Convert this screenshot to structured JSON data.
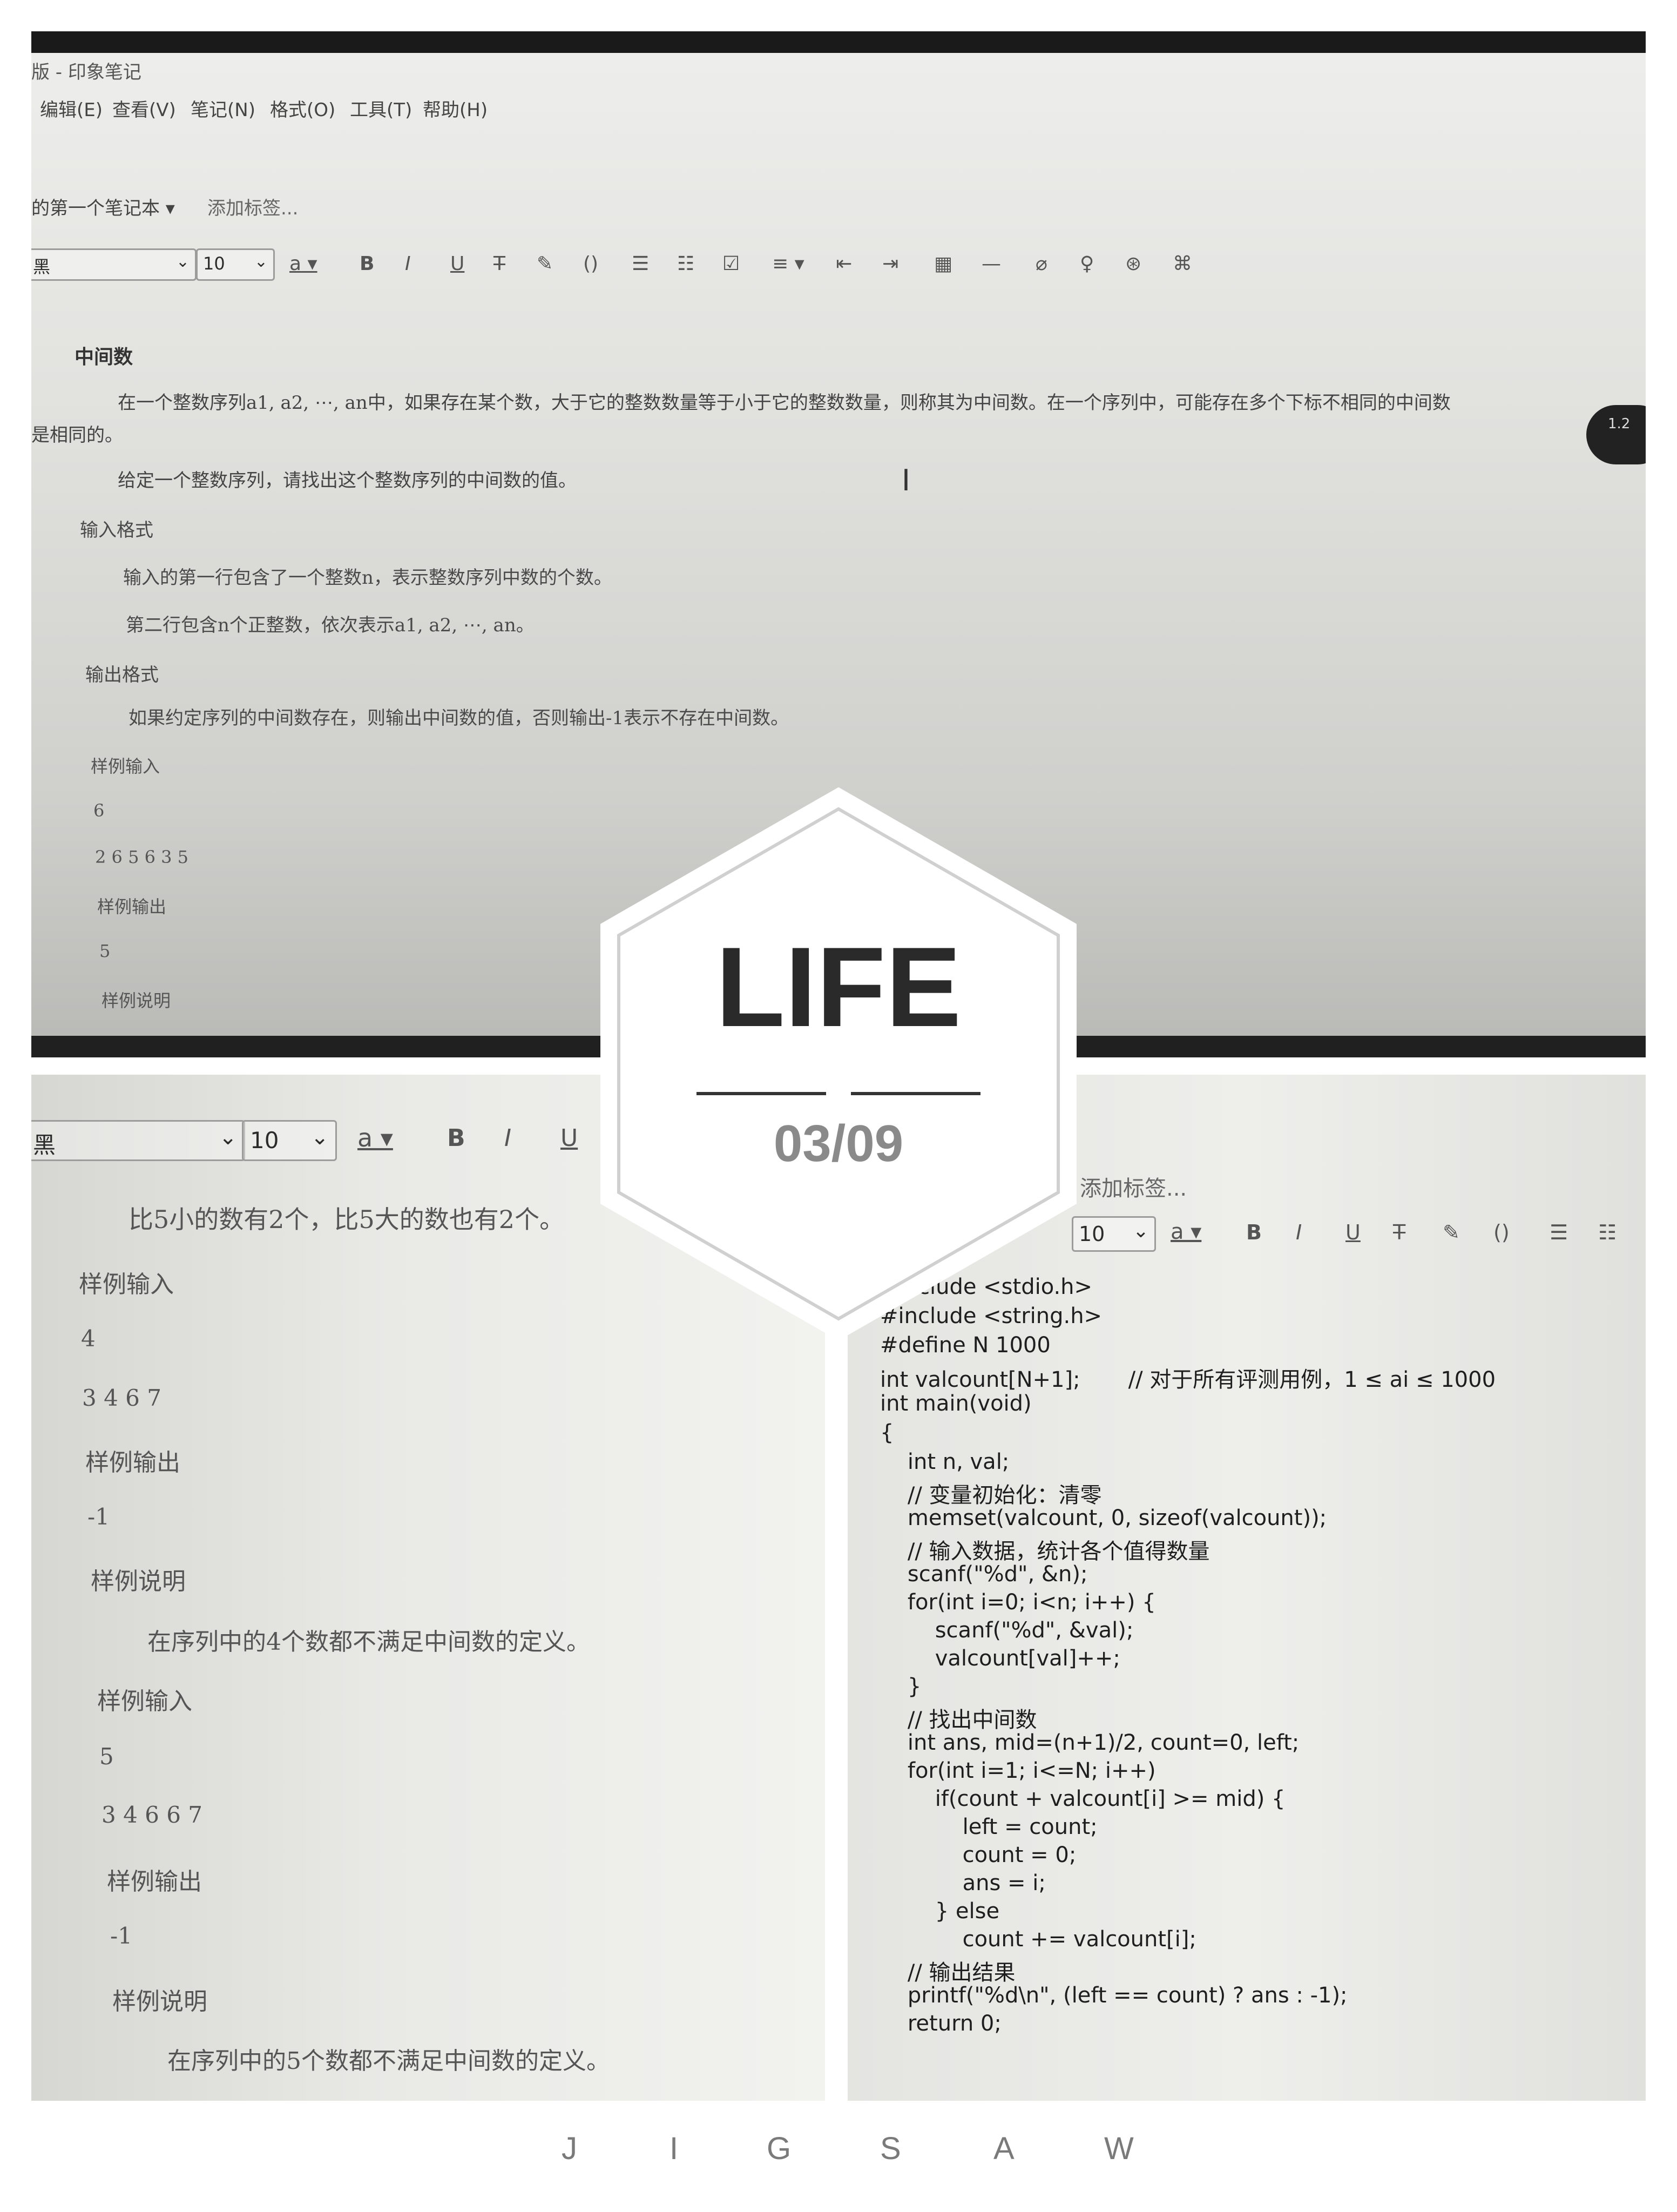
{
  "top": {
    "window_title": "版 - 印象笔记",
    "menu": [
      "编辑(E)",
      "查看(V)",
      "笔记(N)",
      "格式(O)",
      "工具(T)",
      "帮助(H)"
    ],
    "notebook": "的第一个笔记本 ▾",
    "add_tag": "添加标签...",
    "font_name": "黑",
    "font_size": "10",
    "heading": "中间数",
    "para1": "在一个整数序列a1, a2, ⋯, an中，如果存在某个数，大于它的整数数量等于小于它的整数数量，则称其为中间数。在一个序列中，可能存在多个下标不相同的中间数",
    "para1b": "是相同的。",
    "para2": "给定一个整数序列，请找出这个整数序列的中间数的值。",
    "input_format": "输入格式",
    "input_line1": "输入的第一行包含了一个整数n，表示整数序列中数的个数。",
    "input_line2": "第二行包含n个正整数，依次表示a1, a2, ⋯, an。",
    "output_format": "输出格式",
    "output_line": "如果约定序列的中间数存在，则输出中间数的值，否则输出-1表示不存在中间数。",
    "sample_in": "样例输入",
    "sample_in_n": "6",
    "sample_in_vals": "2 6 5 6 3 5",
    "sample_out": "样例输出",
    "sample_out_val": "5",
    "sample_note": "样例说明",
    "bubble": "1.2"
  },
  "bottom_left": {
    "font_name": "黑",
    "font_size": "10",
    "line0": "比5小的数有2个，比5大的数也有2个。",
    "in1": "样例输入",
    "in1_n": "4",
    "in1_vals": "3 4 6 7",
    "out1": "样例输出",
    "out1_val": "-1",
    "note1": "样例说明",
    "note1_text": "在序列中的4个数都不满足中间数的定义。",
    "in2": "样例输入",
    "in2_n": "5",
    "in2_vals": "3 4 6 6 7",
    "out2": "样例输出",
    "out2_val": "-1",
    "note2": "样例说明",
    "note2_text": "在序列中的5个数都不满足中间数的定义。"
  },
  "bottom_right": {
    "add_tag": "添加标签...",
    "font_size": "10",
    "code": [
      "#include <stdio.h>",
      "#include <string.h>",
      "#define N 1000",
      "int valcount[N+1];       // 对于所有评测用例，1 ≤ ai ≤ 1000",
      "int main(void)",
      "{",
      "    int n, val;",
      "    // 变量初始化：清零",
      "    memset(valcount, 0, sizeof(valcount));",
      "    // 输入数据，统计各个值得数量",
      "    scanf(\"%d\", &n);",
      "    for(int i=0; i<n; i++) {",
      "        scanf(\"%d\", &val);",
      "        valcount[val]++;",
      "    }",
      "    // 找出中间数",
      "    int ans, mid=(n+1)/2, count=0, left;",
      "    for(int i=1; i<=N; i++)",
      "        if(count + valcount[i] >= mid) {",
      "            left = count;",
      "            count = 0;",
      "            ans = i;",
      "        } else",
      "            count += valcount[i];",
      "    // 输出结果",
      "    printf(\"%d\\n\", (left == count) ? ans : -1);",
      "    return 0;"
    ]
  },
  "badge": {
    "title": "LIFE",
    "date": "03/09"
  },
  "footer": [
    "J",
    "I",
    "G",
    "S",
    "A",
    "W"
  ]
}
